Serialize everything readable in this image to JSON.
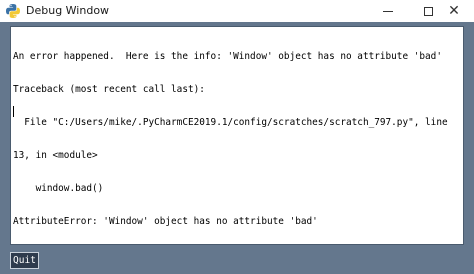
{
  "window": {
    "title": "Debug Window",
    "app_icon": "python-logo-icon",
    "controls": {
      "minimize_icon": "minimize-icon",
      "maximize_icon": "maximize-icon",
      "close_icon": "close-icon",
      "close_glyph": "✕"
    }
  },
  "output": {
    "lines": [
      "An error happened.  Here is the info: 'Window' object has no attribute 'bad'",
      "Traceback (most recent call last):",
      "  File \"C:/Users/mike/.PyCharmCE2019.1/config/scratches/scratch_797.py\", line",
      "13, in <module>",
      "    window.bad()",
      "AttributeError: 'Window' object has no attribute 'bad'"
    ]
  },
  "buttons": {
    "quit": "Quit"
  },
  "colors": {
    "background": "#64778d",
    "button_bg": "#2e3b4d",
    "button_text": "#ffffff"
  }
}
